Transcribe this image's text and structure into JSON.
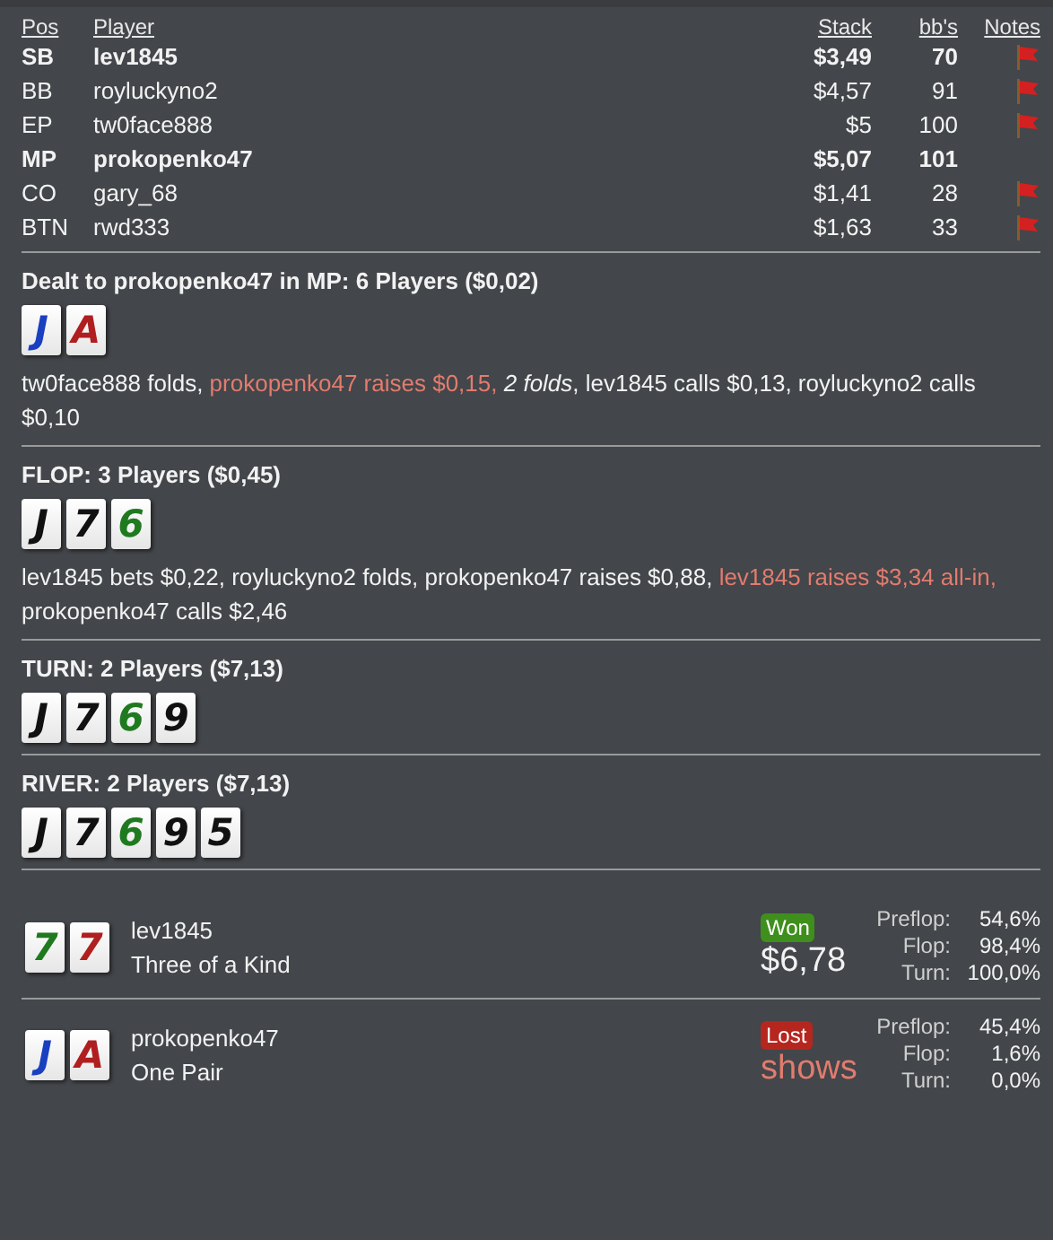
{
  "players": {
    "columns": [
      "Pos",
      "Player",
      "Stack",
      "bb's",
      "Notes"
    ],
    "rows": [
      {
        "pos": "SB",
        "name": "lev1845",
        "stack": "$3,49",
        "bbs": "70",
        "bold": true,
        "has_note": true
      },
      {
        "pos": "BB",
        "name": "royluckyno2",
        "stack": "$4,57",
        "bbs": "91",
        "bold": false,
        "has_note": true
      },
      {
        "pos": "EP",
        "name": "tw0face888",
        "stack": "$5",
        "bbs": "100",
        "bold": false,
        "has_note": true
      },
      {
        "pos": "MP",
        "name": "prokopenko47",
        "stack": "$5,07",
        "bbs": "101",
        "bold": true,
        "has_note": false
      },
      {
        "pos": "CO",
        "name": "gary_68",
        "stack": "$1,41",
        "bbs": "28",
        "bold": false,
        "has_note": true
      },
      {
        "pos": "BTN",
        "name": "rwd333",
        "stack": "$1,63",
        "bbs": "33",
        "bold": false,
        "has_note": true
      }
    ]
  },
  "streets": [
    {
      "title": "Dealt to prokopenko47 in MP: 6 Players ($0,02)",
      "cards": [
        {
          "rank": "J",
          "color": "#1a3fc0"
        },
        {
          "rank": "A",
          "color": "#b01f1f"
        }
      ],
      "actions": [
        {
          "kind": "normal",
          "text": "tw0face888 folds, "
        },
        {
          "kind": "hero",
          "text": "prokopenko47 raises $0,15, "
        },
        {
          "kind": "italic",
          "text": "2 folds"
        },
        {
          "kind": "normal",
          "text": ", lev1845 calls $0,13, royluckyno2 calls $0,10"
        }
      ]
    },
    {
      "title": "FLOP: 3 Players ($0,45)",
      "cards": [
        {
          "rank": "J",
          "color": "#111111"
        },
        {
          "rank": "7",
          "color": "#111111"
        },
        {
          "rank": "6",
          "color": "#1f7a1f"
        }
      ],
      "actions": [
        {
          "kind": "normal",
          "text": "lev1845 bets $0,22, royluckyno2 folds, prokopenko47 raises $0,88, "
        },
        {
          "kind": "hero",
          "text": "lev1845 raises $3,34 all-in,"
        },
        {
          "kind": "normal",
          "text": " prokopenko47 calls $2,46"
        }
      ]
    },
    {
      "title": "TURN: 2 Players ($7,13)",
      "cards": [
        {
          "rank": "J",
          "color": "#111111"
        },
        {
          "rank": "7",
          "color": "#111111"
        },
        {
          "rank": "6",
          "color": "#1f7a1f"
        },
        {
          "rank": "9",
          "color": "#111111"
        }
      ]
    },
    {
      "title": "RIVER: 2 Players ($7,13)",
      "cards": [
        {
          "rank": "J",
          "color": "#111111"
        },
        {
          "rank": "7",
          "color": "#111111"
        },
        {
          "rank": "6",
          "color": "#1f7a1f"
        },
        {
          "rank": "9",
          "color": "#111111"
        },
        {
          "rank": "5",
          "color": "#111111"
        }
      ]
    }
  ],
  "results": [
    {
      "cards": [
        {
          "rank": "7",
          "color": "#1f7a1f"
        },
        {
          "rank": "7",
          "color": "#b01f1f"
        }
      ],
      "name": "lev1845",
      "hand": "Three of a Kind",
      "kind": "won",
      "badge": "Won",
      "amount": "$6,78",
      "equity": [
        {
          "label": "Preflop:",
          "value": "54,6%"
        },
        {
          "label": "Flop:",
          "value": "98,4%"
        },
        {
          "label": "Turn:",
          "value": "100,0%"
        }
      ]
    },
    {
      "cards": [
        {
          "rank": "J",
          "color": "#1a3fc0"
        },
        {
          "rank": "A",
          "color": "#b01f1f"
        }
      ],
      "name": "prokopenko47",
      "hand": "One Pair",
      "kind": "lost",
      "badge": "Lost",
      "amount": "shows",
      "equity": [
        {
          "label": "Preflop:",
          "value": "45,4%"
        },
        {
          "label": "Flop:",
          "value": "1,6%"
        },
        {
          "label": "Turn:",
          "value": "0,0%"
        }
      ]
    }
  ]
}
